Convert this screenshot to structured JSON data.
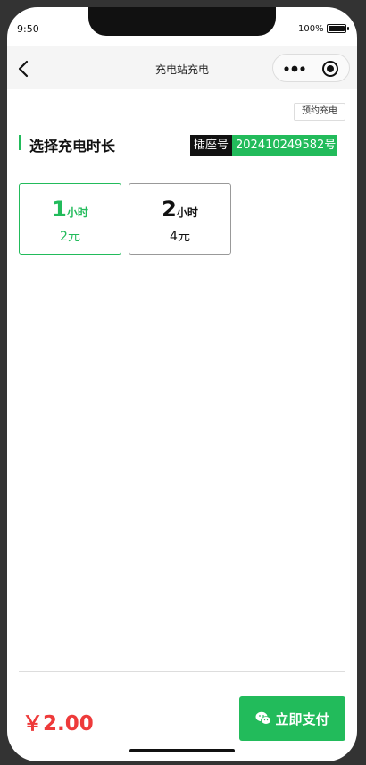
{
  "status_bar": {
    "time": "9:50",
    "battery_text": "100%"
  },
  "navbar": {
    "title": "充电站充电"
  },
  "reserve_button": {
    "label": "预约充电"
  },
  "section": {
    "title": "选择充电时长"
  },
  "socket": {
    "label": "插座号",
    "number": "202410249582号"
  },
  "options": [
    {
      "num": "1",
      "unit": "小时",
      "price": "2元",
      "selected": true
    },
    {
      "num": "2",
      "unit": "小时",
      "price": "4元",
      "selected": false
    }
  ],
  "footer": {
    "price": "￥2.00",
    "pay_label": "立即支付"
  },
  "colors": {
    "accent": "#22bb5b",
    "price": "#ee3a3a"
  }
}
